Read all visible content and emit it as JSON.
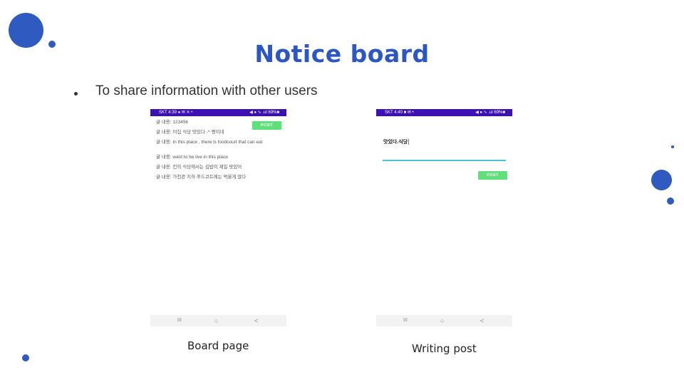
{
  "slide": {
    "title": "Notice board",
    "bullet": "To share information with other users",
    "accent_color": "#2f5bc0"
  },
  "board_page": {
    "status_left": "SKT 4:39 ● ✉ ✕ •",
    "status_right": "◀ ● ∿ .ul 69%■",
    "post_button": "POST",
    "posts": [
      "글 내용: 123456",
      "글 내용: 이집 식당 맛있다 -^ 평이네",
      "글 내용: In this place , there is foodcourt that can eat",
      "글 내용: want to be live in this place",
      "글 내용: 킨의 식당에서는 김밥이 제일 맛있어",
      "글 내용: 가천관 지하 푸드코트에는 먹을게 많다"
    ],
    "nav": {
      "recent": "III",
      "home": "○",
      "back": "<"
    },
    "caption": "Board page"
  },
  "writing_post": {
    "status_left": "SKT 4:40 ■ ✉ •",
    "status_right": "◀ ● ∿ .ul 69%■",
    "input_value": "맛있다.식당",
    "post_button": "POST",
    "nav": {
      "recent": "III",
      "home": "○",
      "back": "<"
    },
    "caption": "Writing post"
  }
}
